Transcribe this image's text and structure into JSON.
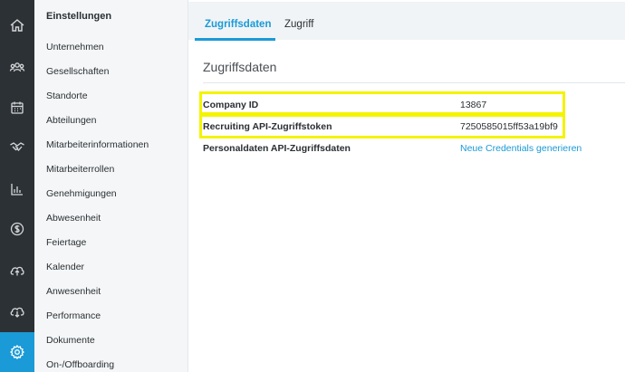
{
  "colors": {
    "rail_bg": "#2c3135",
    "accent": "#1a9ad6",
    "highlight": "#f4f400"
  },
  "rail": {
    "icons": [
      "home-icon",
      "team-icon",
      "calendar-icon",
      "handshake-icon",
      "bar-chart-icon",
      "dollar-icon",
      "cloud-upload-icon",
      "cloud-download-icon",
      "gear-icon"
    ],
    "active": "gear-icon"
  },
  "sidebar": {
    "title": "Einstellungen",
    "items": [
      "Unternehmen",
      "Gesellschaften",
      "Standorte",
      "Abteilungen",
      "Mitarbeiterinformationen",
      "Mitarbeiterrollen",
      "Genehmigungen",
      "Abwesenheit",
      "Feiertage",
      "Kalender",
      "Anwesenheit",
      "Performance",
      "Dokumente",
      "On-/Offboarding"
    ]
  },
  "tabs": {
    "active": "Zugriffsdaten",
    "other": "Zugriff"
  },
  "section": {
    "title": "Zugriffsdaten"
  },
  "rows": [
    {
      "label": "Company ID",
      "value": "13867"
    },
    {
      "label": "Recruiting API-Zugriffstoken",
      "value": "7250585015ff53a19bf9"
    },
    {
      "label": "Personaldaten API-Zugriffsdaten",
      "link": "Neue Credentials generieren"
    }
  ]
}
